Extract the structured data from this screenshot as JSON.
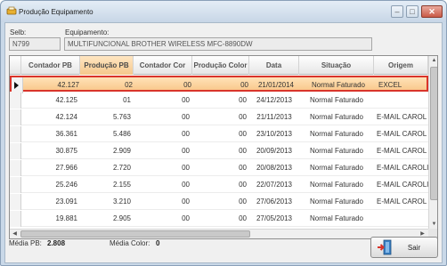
{
  "window": {
    "title": "Produção Equipamento",
    "min_symbol": "–",
    "max_symbol": "□",
    "close_symbol": "✕"
  },
  "form": {
    "selb_label": "Selb:",
    "selb_value": "N799",
    "equipamento_label": "Equipamento:",
    "equipamento_value": "MULTIFUNCIONAL BROTHER WIRELESS MFC-8890DW"
  },
  "grid": {
    "columns": [
      "Contador PB",
      "Produção PB",
      "Contador Cor",
      "Produção Color",
      "Data",
      "Situação",
      "Origem"
    ],
    "rows": [
      {
        "contador_pb": "42.127",
        "producao_pb": "02",
        "contador_cor": "00",
        "producao_color": "00",
        "data": "21/01/2014",
        "situacao": "Normal Faturado",
        "origem": "EXCEL"
      },
      {
        "contador_pb": "42.125",
        "producao_pb": "01",
        "contador_cor": "00",
        "producao_color": "00",
        "data": "24/12/2013",
        "situacao": "Normal Faturado",
        "origem": ""
      },
      {
        "contador_pb": "42.124",
        "producao_pb": "5.763",
        "contador_cor": "00",
        "producao_color": "00",
        "data": "21/11/2013",
        "situacao": "Normal Faturado",
        "origem": "E-MAIL CAROL"
      },
      {
        "contador_pb": "36.361",
        "producao_pb": "5.486",
        "contador_cor": "00",
        "producao_color": "00",
        "data": "23/10/2013",
        "situacao": "Normal Faturado",
        "origem": "E-MAIL CAROL"
      },
      {
        "contador_pb": "30.875",
        "producao_pb": "2.909",
        "contador_cor": "00",
        "producao_color": "00",
        "data": "20/09/2013",
        "situacao": "Normal Faturado",
        "origem": "E-MAIL CAROL"
      },
      {
        "contador_pb": "27.966",
        "producao_pb": "2.720",
        "contador_cor": "00",
        "producao_color": "00",
        "data": "20/08/2013",
        "situacao": "Normal Faturado",
        "origem": "E-MAIL CAROLI..."
      },
      {
        "contador_pb": "25.246",
        "producao_pb": "2.155",
        "contador_cor": "00",
        "producao_color": "00",
        "data": "22/07/2013",
        "situacao": "Normal Faturado",
        "origem": "E-MAIL CAROLI..."
      },
      {
        "contador_pb": "23.091",
        "producao_pb": "3.210",
        "contador_cor": "00",
        "producao_color": "00",
        "data": "27/06/2013",
        "situacao": "Normal Faturado",
        "origem": "E-MAIL CAROL"
      },
      {
        "contador_pb": "19.881",
        "producao_pb": "2.905",
        "contador_cor": "00",
        "producao_color": "00",
        "data": "27/05/2013",
        "situacao": "Normal Faturado",
        "origem": ""
      }
    ]
  },
  "footer": {
    "media_pb_label": "Média PB:",
    "media_pb_value": "2.808",
    "media_color_label": "Média Color:",
    "media_color_value": "0",
    "sair_label": "Sair"
  },
  "colors": {
    "selected_header": "#f5c88c",
    "selected_row": "#f9c98d",
    "selected_row_border": "#d9342a",
    "close_button": "#c95a47"
  },
  "icons": [
    "app-icon",
    "row-indicator-icon",
    "exit-door-icon"
  ]
}
